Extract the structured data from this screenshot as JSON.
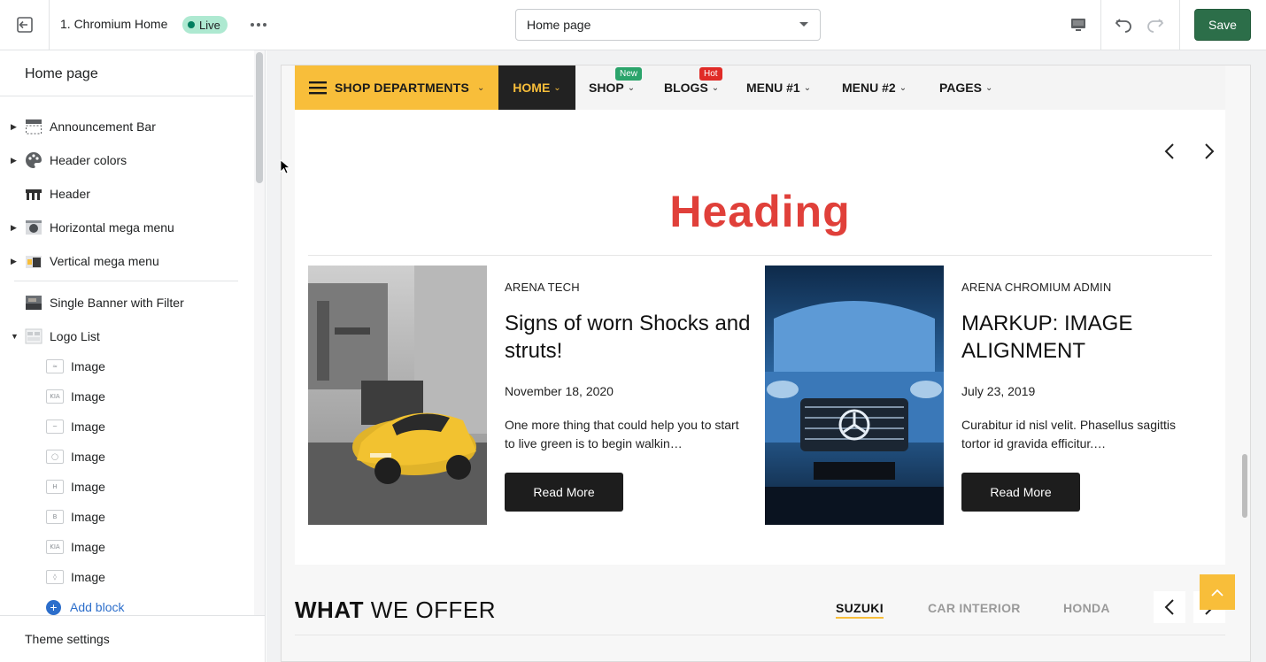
{
  "topbar": {
    "theme_name": "1. Chromium Home",
    "live_label": "Live",
    "page_select_value": "Home page",
    "save_label": "Save",
    "colors": {
      "save": "#2c6e49",
      "live_badge": "#aee9d1"
    }
  },
  "sidebar": {
    "title": "Home page",
    "sections": [
      {
        "label": "Announcement Bar",
        "icon": "announcement-bar-icon",
        "expandable": true
      },
      {
        "label": "Header colors",
        "icon": "palette-icon",
        "expandable": true
      },
      {
        "label": "Header",
        "icon": "header-icon",
        "expandable": false
      },
      {
        "label": "Horizontal mega menu",
        "icon": "mega-menu-thumbnail-icon",
        "expandable": true
      },
      {
        "label": "Vertical mega menu",
        "icon": "vertical-menu-thumbnail-icon",
        "expandable": true
      },
      {
        "label": "Single Banner with Filter",
        "icon": "banner-thumbnail-icon",
        "expandable": false
      },
      {
        "label": "Logo List",
        "icon": "logo-list-icon",
        "expandable": true,
        "expanded": true
      }
    ],
    "logo_blocks": [
      "Image",
      "Image",
      "Image",
      "Image",
      "Image",
      "Image",
      "Image",
      "Image"
    ],
    "add_block_label": "Add block",
    "theme_settings_label": "Theme settings"
  },
  "preview": {
    "nav": {
      "departments_label": "SHOP DEPARTMENTS",
      "home_label": "HOME",
      "items": [
        {
          "label": "SHOP",
          "badge": "New",
          "badge_color": "#2ba46b"
        },
        {
          "label": "BLOGS",
          "badge": "Hot",
          "badge_color": "#e02b27"
        },
        {
          "label": "MENU #1"
        },
        {
          "label": "MENU #2"
        },
        {
          "label": "PAGES"
        }
      ],
      "colors": {
        "departments_bg": "#f8be3a",
        "home_bg": "#222222",
        "home_text": "#f8be3a"
      }
    },
    "blog": {
      "heading": "Heading",
      "heading_color": "#e0403a",
      "posts": [
        {
          "author": "ARENA TECH",
          "title": "Signs of worn Shocks and struts!",
          "date": "November 18, 2020",
          "excerpt": "One more thing that could help you to start to live green is to begin walkin…",
          "button": "Read More"
        },
        {
          "author": "ARENA CHROMIUM ADMIN",
          "title": "MARKUP: IMAGE ALIGNMENT",
          "date": "July 23, 2019",
          "excerpt": "Curabitur id nisl velit. Phasellus sagittis tortor id gravida efficitur.…",
          "button": "Read More"
        }
      ]
    },
    "offer": {
      "title_bold": "WHAT",
      "title_light": "WE OFFER",
      "tabs": [
        {
          "label": "SUZUKI",
          "active": true
        },
        {
          "label": "CAR INTERIOR",
          "active": false
        },
        {
          "label": "HONDA",
          "active": false
        }
      ]
    }
  }
}
